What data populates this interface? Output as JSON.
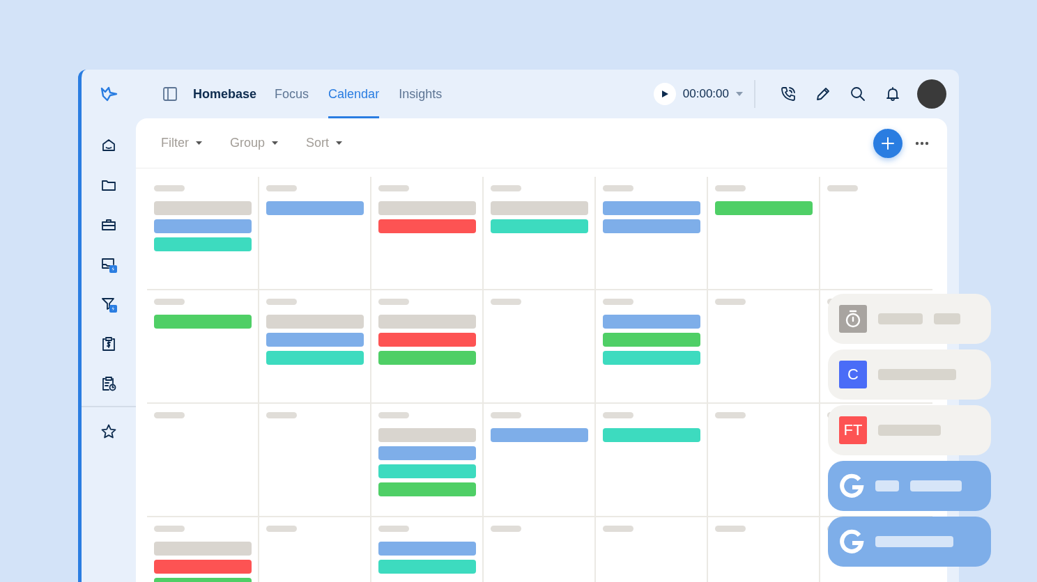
{
  "topbar": {
    "workspace": "Homebase",
    "tabs": [
      {
        "label": "Focus",
        "selected": false
      },
      {
        "label": "Calendar",
        "selected": true
      },
      {
        "label": "Insights",
        "selected": false
      }
    ],
    "timer": {
      "time": "00:00:00"
    }
  },
  "toolbar": {
    "menus": [
      "Filter",
      "Group",
      "Sort"
    ]
  },
  "calendar": {
    "rows": [
      {
        "cells": [
          {
            "events": [
              {
                "color": "#d9d5cf"
              },
              {
                "color": "#7eaee9"
              },
              {
                "color": "#3ddbbf"
              }
            ]
          },
          {
            "events": [
              {
                "color": "#7eaee9"
              }
            ]
          },
          {
            "events": [
              {
                "color": "#d9d5cf"
              },
              {
                "color": "#fd5353"
              }
            ]
          },
          {
            "events": [
              {
                "color": "#d9d5cf"
              },
              {
                "color": "#3ddbbf"
              }
            ]
          },
          {
            "events": [
              {
                "color": "#7eaee9"
              },
              {
                "color": "#7eaee9"
              }
            ]
          },
          {
            "events": [
              {
                "color": "#4fcf66"
              }
            ]
          },
          {}
        ]
      },
      {
        "cells": [
          {
            "events": [
              {
                "color": "#4fcf66"
              }
            ]
          },
          {
            "events": [
              {
                "color": "#d9d5cf"
              },
              {
                "color": "#7eaee9"
              },
              {
                "color": "#3ddbbf"
              }
            ]
          },
          {
            "events": [
              {
                "color": "#d9d5cf"
              },
              {
                "color": "#fd5353"
              },
              {
                "color": "#4fcf66"
              }
            ]
          },
          {},
          {
            "events": [
              {
                "color": "#7eaee9"
              },
              {
                "color": "#4fcf66"
              },
              {
                "color": "#3ddbbf"
              }
            ]
          },
          {},
          {}
        ]
      },
      {
        "cells": [
          {},
          {},
          {
            "events": [
              {
                "color": "#d9d5cf"
              },
              {
                "color": "#7eaee9"
              },
              {
                "color": "#3ddbbf"
              },
              {
                "color": "#4fcf66"
              }
            ]
          },
          {
            "events": [
              {
                "color": "#7eaee9"
              }
            ]
          },
          {
            "events": [
              {
                "color": "#3ddbbf"
              }
            ]
          },
          {},
          {}
        ]
      },
      {
        "cells": [
          {
            "events": [
              {
                "color": "#d9d5cf"
              },
              {
                "color": "#fd5353"
              },
              {
                "color": "#4fcf66"
              }
            ]
          },
          {},
          {
            "events": [
              {
                "color": "#7eaee9"
              },
              {
                "color": "#3ddbbf"
              }
            ]
          },
          {},
          {},
          {},
          {}
        ]
      }
    ]
  },
  "integrations": [
    {
      "kind": "timer"
    },
    {
      "kind": "letter",
      "label": "C",
      "color": "#4a6cf7"
    },
    {
      "kind": "letter",
      "label": "FT",
      "color": "#fd5353"
    },
    {
      "kind": "google"
    },
    {
      "kind": "google"
    }
  ]
}
